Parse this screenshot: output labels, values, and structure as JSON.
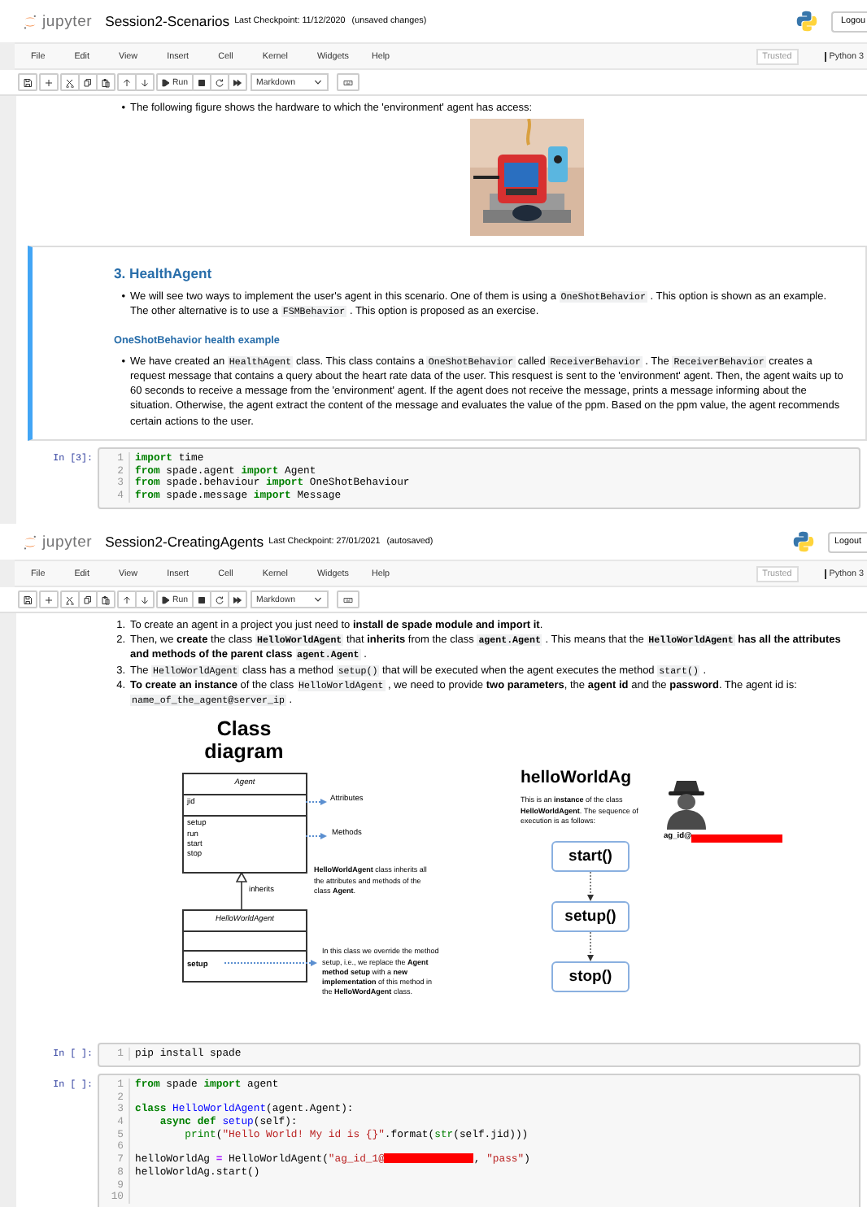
{
  "notebooks": [
    {
      "header": {
        "brand": "jupyter",
        "title": "Session2-Scenarios",
        "checkpoint": "Last Checkpoint: 11/12/2020",
        "status": "(unsaved changes)",
        "logout": "Logou"
      },
      "menu": [
        "File",
        "Edit",
        "View",
        "Insert",
        "Cell",
        "Kernel",
        "Widgets",
        "Help"
      ],
      "trusted": "Trusted",
      "kernel": "Python 3",
      "toolbar": [
        [
          {
            "kind": "save"
          }
        ],
        [
          {
            "kind": "plus"
          }
        ],
        [
          {
            "kind": "cut"
          },
          {
            "kind": "copy"
          },
          {
            "kind": "paste"
          }
        ],
        [
          {
            "kind": "up"
          },
          {
            "kind": "down"
          }
        ],
        [
          {
            "kind": "run",
            "label": "Run"
          },
          {
            "kind": "stop"
          },
          {
            "kind": "restart"
          },
          {
            "kind": "fastforward"
          }
        ]
      ],
      "cell_type": "Markdown",
      "cells": [
        {
          "kind": "markdown",
          "selected": false,
          "blocks": [
            {
              "kind": "list",
              "items": [
                {
                  "marker": "•",
                  "segments": [
                    {
                      "kind": "text",
                      "text": "The following figure shows the hardware to which the 'environment' agent has access:"
                    }
                  ]
                }
              ]
            },
            {
              "kind": "picture"
            }
          ]
        },
        {
          "kind": "markdown",
          "selected": true,
          "blocks": [
            {
              "kind": "heading",
              "text": "3. HealthAgent"
            },
            {
              "kind": "list",
              "items": [
                {
                  "marker": "•",
                  "segments": [
                    {
                      "kind": "text",
                      "text": "We will see two ways to implement the user's agent in this scenario. One of them is using a "
                    },
                    {
                      "kind": "code",
                      "text": "OneShotBehavior"
                    },
                    {
                      "kind": "text",
                      "text": " . This option is shown as an example. The other alternative is to use a "
                    },
                    {
                      "kind": "code",
                      "text": "FSMBehavior"
                    },
                    {
                      "kind": "text",
                      "text": " . This option is proposed as an exercise."
                    }
                  ]
                }
              ]
            },
            {
              "kind": "subheading",
              "text": "OneShotBehavior health example"
            },
            {
              "kind": "list",
              "items": [
                {
                  "marker": "•",
                  "segments": [
                    {
                      "kind": "text",
                      "text": "We have created an "
                    },
                    {
                      "kind": "code",
                      "text": "HealthAgent"
                    },
                    {
                      "kind": "text",
                      "text": " class. This class contains a "
                    },
                    {
                      "kind": "code",
                      "text": "OneShotBehavior"
                    },
                    {
                      "kind": "text",
                      "text": " called "
                    },
                    {
                      "kind": "code",
                      "text": "ReceiverBehavior"
                    },
                    {
                      "kind": "text",
                      "text": " . The "
                    },
                    {
                      "kind": "code",
                      "text": "ReceiverBehavior"
                    },
                    {
                      "kind": "text",
                      "text": " creates a request message that contains a query about the heart rate data of the user. This resquest is sent to the 'environment' agent. Then, the agent waits up to 60 seconds to receive a message from the 'environment' agent. If the agent does not receive the message, prints a message informing about the situation. Otherwise, the agent extract the content of the message and evaluates the value of the ppm. Based on the ppm value, the agent recommends certain actions to the user."
                    }
                  ]
                }
              ]
            }
          ]
        },
        {
          "kind": "code",
          "selected": false,
          "prompt": "In [3]:",
          "lines": [
            {
              "number": "1",
              "tokens": [
                {
                  "kind": "keyword",
                  "text": "import"
                },
                {
                  "kind": "plain",
                  "text": " time"
                }
              ]
            },
            {
              "number": "2",
              "tokens": [
                {
                  "kind": "keyword",
                  "text": "from"
                },
                {
                  "kind": "plain",
                  "text": " spade.agent "
                },
                {
                  "kind": "keyword",
                  "text": "import"
                },
                {
                  "kind": "plain",
                  "text": " Agent"
                }
              ]
            },
            {
              "number": "3",
              "tokens": [
                {
                  "kind": "keyword",
                  "text": "from"
                },
                {
                  "kind": "plain",
                  "text": " spade.behaviour "
                },
                {
                  "kind": "keyword",
                  "text": "import"
                },
                {
                  "kind": "plain",
                  "text": " OneShotBehaviour"
                }
              ]
            },
            {
              "number": "4",
              "tokens": [
                {
                  "kind": "keyword",
                  "text": "from"
                },
                {
                  "kind": "plain",
                  "text": " spade.message "
                },
                {
                  "kind": "keyword",
                  "text": "import"
                },
                {
                  "kind": "plain",
                  "text": " Message"
                }
              ]
            }
          ]
        }
      ]
    },
    {
      "header": {
        "brand": "jupyter",
        "title": "Session2-CreatingAgents",
        "checkpoint": "Last Checkpoint: 27/01/2021",
        "status": "(autosaved)",
        "logout": "Logout"
      },
      "menu": [
        "File",
        "Edit",
        "View",
        "Insert",
        "Cell",
        "Kernel",
        "Widgets",
        "Help"
      ],
      "trusted": "Trusted",
      "kernel": "Python 3",
      "toolbar": [
        [
          {
            "kind": "save"
          }
        ],
        [
          {
            "kind": "plus"
          }
        ],
        [
          {
            "kind": "cut"
          },
          {
            "kind": "copy"
          },
          {
            "kind": "paste"
          }
        ],
        [
          {
            "kind": "up"
          },
          {
            "kind": "down"
          }
        ],
        [
          {
            "kind": "run",
            "label": "Run"
          },
          {
            "kind": "stop"
          },
          {
            "kind": "restart"
          },
          {
            "kind": "fastforward"
          }
        ]
      ],
      "cell_type": "Markdown",
      "cells": [
        {
          "kind": "markdown",
          "selected": false,
          "blocks": [
            {
              "kind": "list",
              "items": [
                {
                  "marker": "1.",
                  "segments": [
                    {
                      "kind": "text",
                      "text": "To create an agent in a project you just need to "
                    },
                    {
                      "kind": "bold",
                      "text": "install de spade module and import it"
                    },
                    {
                      "kind": "text",
                      "text": "."
                    }
                  ]
                },
                {
                  "marker": "2.",
                  "segments": [
                    {
                      "kind": "text",
                      "text": "Then, we "
                    },
                    {
                      "kind": "bold",
                      "text": "create"
                    },
                    {
                      "kind": "text",
                      "text": " the class "
                    },
                    {
                      "kind": "boldcode",
                      "text": "HelloWorldAgent"
                    },
                    {
                      "kind": "text",
                      "text": " that "
                    },
                    {
                      "kind": "bold",
                      "text": "inherits"
                    },
                    {
                      "kind": "text",
                      "text": " from the class "
                    },
                    {
                      "kind": "boldcode",
                      "text": "agent.Agent"
                    },
                    {
                      "kind": "text",
                      "text": " . This means that the "
                    },
                    {
                      "kind": "boldcode",
                      "text": "HelloWorldAgent"
                    },
                    {
                      "kind": "bold",
                      "text": " has all the attributes and methods of the parent class "
                    },
                    {
                      "kind": "boldcode",
                      "text": "agent.Agent"
                    },
                    {
                      "kind": "text",
                      "text": " ."
                    }
                  ]
                },
                {
                  "marker": "3.",
                  "segments": [
                    {
                      "kind": "text",
                      "text": "The "
                    },
                    {
                      "kind": "code",
                      "text": "HelloWorldAgent"
                    },
                    {
                      "kind": "text",
                      "text": " class has a method "
                    },
                    {
                      "kind": "code",
                      "text": "setup()"
                    },
                    {
                      "kind": "text",
                      "text": " that will be executed when the agent executes the method "
                    },
                    {
                      "kind": "code",
                      "text": "start()"
                    },
                    {
                      "kind": "text",
                      "text": " ."
                    }
                  ]
                },
                {
                  "marker": "4.",
                  "segments": [
                    {
                      "kind": "bold",
                      "text": "To create an instance"
                    },
                    {
                      "kind": "text",
                      "text": " of the class "
                    },
                    {
                      "kind": "code",
                      "text": "HelloWorldAgent"
                    },
                    {
                      "kind": "text",
                      "text": " , we need to provide "
                    },
                    {
                      "kind": "bold",
                      "text": "two parameters"
                    },
                    {
                      "kind": "text",
                      "text": ", the "
                    },
                    {
                      "kind": "bold",
                      "text": "agent id"
                    },
                    {
                      "kind": "text",
                      "text": " and the "
                    },
                    {
                      "kind": "bold",
                      "text": "password"
                    },
                    {
                      "kind": "text",
                      "text": ". The agent id is: "
                    },
                    {
                      "kind": "code",
                      "text": "name_of_the_agent@server_ip"
                    },
                    {
                      "kind": "text",
                      "text": " ."
                    }
                  ]
                }
              ]
            },
            {
              "kind": "diagram",
              "title": "Class diagram",
              "base_class": {
                "name": "Agent",
                "attributes": [
                  "jid"
                ],
                "methods": [
                  "setup",
                  "run",
                  "start",
                  "stop"
                ]
              },
              "attributes_label": "Attributes",
              "methods_label": "Methods",
              "inherits_label": "inherits",
              "inherit_note": "**HelloWorldAgent** class inherits all the attributes and methods of the class **Agent**.",
              "sub_class": {
                "name": "HelloWorldAgent",
                "methods": [
                  "setup"
                ]
              },
              "override_note": "In this class we override the method setup, i.e., we replace the **Agent method setup** with a **new implementation** of this method in the **HelloWordAgent** class.",
              "instance_title": "helloWorldAg",
              "instance_note": "This is an **instance** of the class **HelloWorldAgent**. The sequence of execution is as follows:",
              "agent_label": "ag_id@",
              "sequence": [
                "start()",
                "setup()",
                "stop()"
              ]
            }
          ]
        },
        {
          "kind": "code",
          "selected": false,
          "prompt": "In [ ]:",
          "lines": [
            {
              "number": "1",
              "tokens": [
                {
                  "kind": "plain",
                  "text": "pip install spade"
                }
              ]
            }
          ]
        },
        {
          "kind": "code",
          "selected": false,
          "prompt": "In [ ]:",
          "lines": [
            {
              "number": "1",
              "tokens": [
                {
                  "kind": "keyword",
                  "text": "from"
                },
                {
                  "kind": "plain",
                  "text": " spade "
                },
                {
                  "kind": "keyword",
                  "text": "import"
                },
                {
                  "kind": "plain",
                  "text": " agent"
                }
              ]
            },
            {
              "number": "2"
            },
            {
              "number": "3",
              "tokens": [
                {
                  "kind": "keyword",
                  "text": "class "
                },
                {
                  "kind": "name",
                  "text": "HelloWorldAgent"
                },
                {
                  "kind": "plain",
                  "text": "(agent.Agent):"
                }
              ]
            },
            {
              "number": "4",
              "tokens": [
                {
                  "kind": "keyword",
                  "text": "    async def "
                },
                {
                  "kind": "name",
                  "text": "setup"
                },
                {
                  "kind": "plain",
                  "text": "(self):"
                }
              ]
            },
            {
              "number": "5",
              "tokens": [
                {
                  "kind": "builtin",
                  "text": "        print"
                },
                {
                  "kind": "plain",
                  "text": "("
                },
                {
                  "kind": "string",
                  "text": "\"Hello World! My id is {}\""
                },
                {
                  "kind": "plain",
                  "text": ".format("
                },
                {
                  "kind": "builtin",
                  "text": "str"
                },
                {
                  "kind": "plain",
                  "text": "(self.jid)))"
                }
              ]
            },
            {
              "number": "6"
            },
            {
              "number": "7",
              "tokens": [
                {
                  "kind": "plain",
                  "text": "helloWorldAg "
                },
                {
                  "kind": "operator",
                  "text": "="
                },
                {
                  "kind": "plain",
                  "text": " HelloWorldAgent("
                },
                {
                  "kind": "string",
                  "text": "\"ag_id_1@"
                },
                {
                  "kind": "redacted"
                },
                {
                  "kind": "plain",
                  "text": ", "
                },
                {
                  "kind": "string",
                  "text": "\"pass\""
                },
                {
                  "kind": "plain",
                  "text": ")"
                }
              ]
            },
            {
              "number": "8",
              "tokens": [
                {
                  "kind": "plain",
                  "text": "helloWorldAg.start()"
                }
              ]
            },
            {
              "number": "9"
            },
            {
              "number": "10"
            }
          ]
        }
      ]
    }
  ]
}
